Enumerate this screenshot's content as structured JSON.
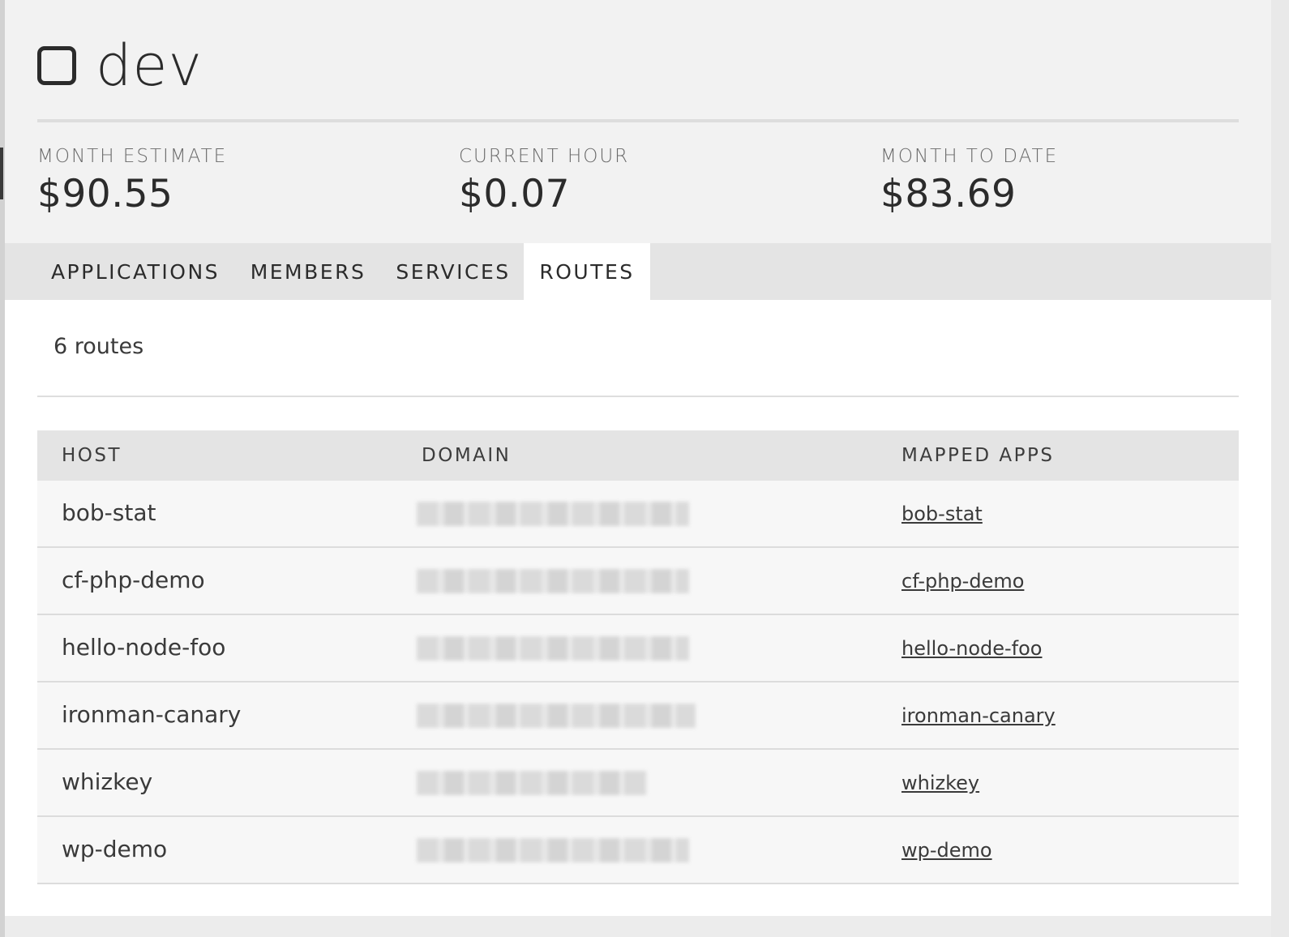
{
  "space": {
    "icon": "square-outline-icon",
    "name": "dev"
  },
  "stats": [
    {
      "label": "MONTH ESTIMATE",
      "value": "$90.55"
    },
    {
      "label": "CURRENT HOUR",
      "value": "$0.07"
    },
    {
      "label": "MONTH TO DATE",
      "value": "$83.69"
    }
  ],
  "tabs": [
    {
      "label": "APPLICATIONS",
      "active": false
    },
    {
      "label": "MEMBERS",
      "active": false
    },
    {
      "label": "SERVICES",
      "active": false
    },
    {
      "label": "ROUTES",
      "active": true
    }
  ],
  "routes": {
    "count_text": "6 routes",
    "columns": [
      "HOST",
      "DOMAIN",
      "MAPPED APPS"
    ],
    "rows": [
      {
        "host": "bob-stat",
        "domain": "",
        "app": "bob-stat"
      },
      {
        "host": "cf-php-demo",
        "domain": "",
        "app": "cf-php-demo"
      },
      {
        "host": "hello-node-foo",
        "domain": "",
        "app": "hello-node-foo"
      },
      {
        "host": "ironman-canary",
        "domain": "",
        "app": "ironman-canary"
      },
      {
        "host": "whizkey",
        "domain": "",
        "app": "whizkey"
      },
      {
        "host": "wp-demo",
        "domain": "",
        "app": "wp-demo"
      }
    ]
  }
}
